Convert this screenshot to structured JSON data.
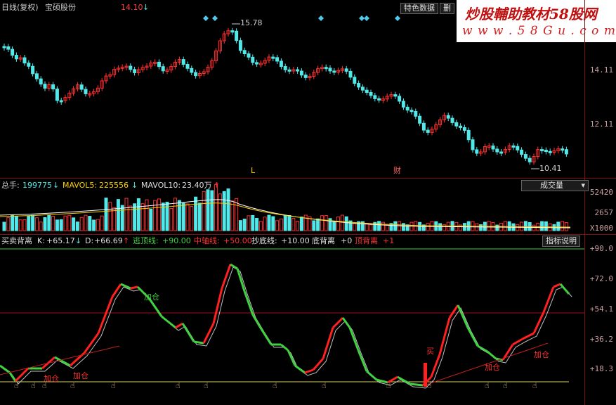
{
  "header": {
    "period": "日线(复权)",
    "stock_name": "宝硕股份",
    "price": "14.10",
    "price_arrow": "↓",
    "tabs": [
      "特色数据",
      "删"
    ]
  },
  "watermark": {
    "title": "炒股輔助教材58股网",
    "url": "w w w . 5 8 G u . c o m"
  },
  "price_chart": {
    "high_label": "15.78",
    "low_label": "10.41",
    "axis": [
      "14.11",
      "12.11"
    ],
    "markers": [
      "L",
      "财"
    ]
  },
  "volume_panel": {
    "label": "总手:",
    "value": "199775",
    "value_arrow": "↓",
    "mavol5_label": "MAVOL5:",
    "mavol5": "225556",
    "mavol5_arrow": "↓",
    "mavol10_label": "MAVOL10:",
    "mavol10": "23.40万",
    "mavol10_arrow": "↑",
    "dropdown": "成交量",
    "axis": [
      "52420",
      "2657",
      "X1000"
    ]
  },
  "indicator_panel": {
    "name": "买卖背离",
    "k_label": "K:",
    "k": "+65.17",
    "k_arrow": "↓",
    "d_label": "D:",
    "d": "+66.69",
    "d_arrow": "↑",
    "escape_label": "逃顶线:",
    "escape": "+90.00",
    "mid_label": "中轴线:",
    "mid": "+50.00",
    "bottom_label": "抄底线:",
    "bottom": "+10.00",
    "div_bottom_label": "底背离",
    "div_bottom": "+0",
    "div_top_label": "顶背离",
    "div_top": "+1",
    "help_button": "指标说明",
    "axis": [
      "+90.0",
      "+72.0",
      "+54.1",
      "+36.2",
      "+18.3"
    ],
    "annotations": [
      "加仓",
      "加仓",
      "加仓",
      "加仓",
      "加仓",
      "买"
    ]
  },
  "colors": {
    "up": "#ff3030",
    "down": "#50e8e8",
    "grid": "#7a1010",
    "k_up": "#ff2020",
    "k_down": "#40d040"
  }
}
